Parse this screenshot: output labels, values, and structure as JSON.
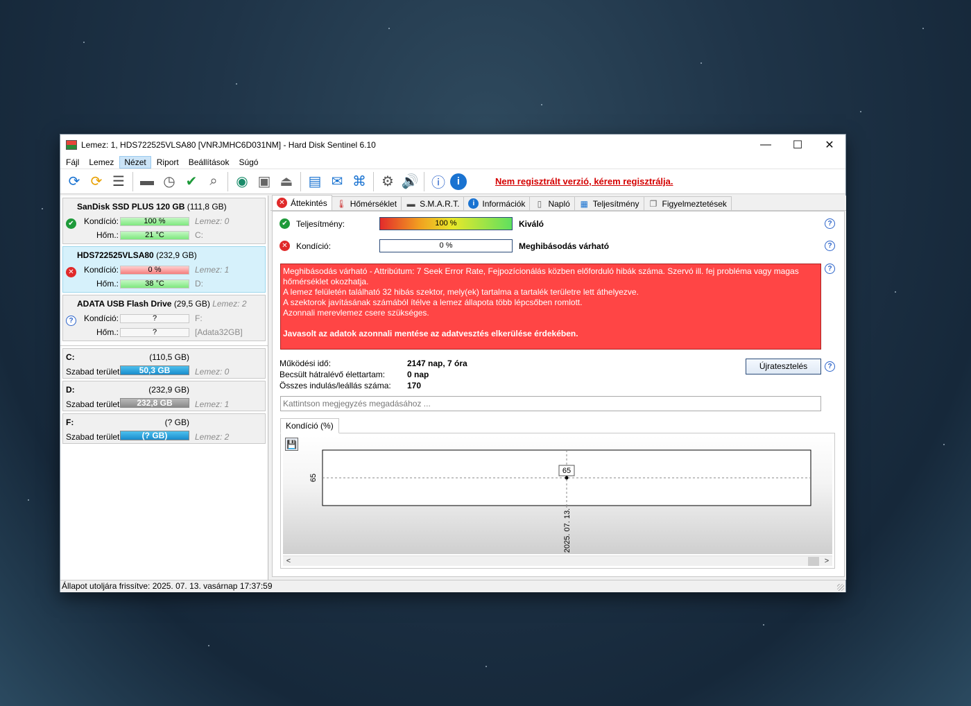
{
  "window": {
    "title": "Lemez: 1, HDS722525VLSA80 [VNRJMHC6D031NM]  -  Hard Disk Sentinel 6.10",
    "controls": {
      "minimize": "—",
      "maximize": "☐",
      "close": "✕"
    }
  },
  "menu": [
    "Fájl",
    "Lemez",
    "Nézet",
    "Riport",
    "Beállítások",
    "Súgó"
  ],
  "toolbar": {
    "icons": [
      "refresh-icon",
      "refresh-all-icon",
      "disk-list-icon",
      "disk-test-icon",
      "disk-schedule-icon",
      "disk-ok-icon",
      "disk-search-icon",
      "globe-icon",
      "drive-icon",
      "drive-eject-icon",
      "notepad-icon",
      "mail-icon",
      "network-icon",
      "settings-gear-icon",
      "speaker-icon",
      "help-icon",
      "info-icon"
    ],
    "register_link": "Nem regisztrált verzió, kérem regisztrálja."
  },
  "disks": [
    {
      "name": "SanDisk SSD PLUS 120 GB",
      "size": "(111,8 GB)",
      "status": "ok",
      "health_label": "Kondíció:",
      "health": "100 %",
      "health_color": "green",
      "disk_ref": "Lemez: 0",
      "temp_label": "Hőm.:",
      "temp": "21 °C",
      "temp_color": "green",
      "volume": "C:"
    },
    {
      "name": "HDS722525VLSA80",
      "size": "(232,9 GB)",
      "status": "error",
      "health_label": "Kondíció:",
      "health": "0 %",
      "health_color": "red",
      "disk_ref": "Lemez: 1",
      "temp_label": "Hőm.:",
      "temp": "38 °C",
      "temp_color": "green",
      "volume": "D:"
    },
    {
      "name": "ADATA   USB Flash Drive",
      "size": "(29,5 GB)",
      "size_extra": "Lemez: 2",
      "status": "unknown",
      "health_label": "Kondíció:",
      "health": "?",
      "health_color": "empty",
      "disk_ref": "F:",
      "temp_label": "Hőm.:",
      "temp": "?",
      "temp_color": "empty",
      "volume": "[Adata32GB]"
    }
  ],
  "volumes": [
    {
      "letter": "C:",
      "size": "(110,5 GB)",
      "label": "Szabad terület",
      "free": "50,3 GB",
      "bar": "blue",
      "disk_ref": "Lemez: 0"
    },
    {
      "letter": "D:",
      "size": "(232,9 GB)",
      "label": "Szabad terület",
      "free": "232,8 GB",
      "bar": "grey",
      "disk_ref": "Lemez: 1"
    },
    {
      "letter": "F:",
      "size": "(? GB)",
      "label": "Szabad terület",
      "free": "(? GB)",
      "bar": "blue",
      "disk_ref": "Lemez: 2"
    }
  ],
  "tabs": [
    {
      "label": "Áttekintés",
      "icon": "error-x-icon"
    },
    {
      "label": "Hőmérséklet",
      "icon": "thermometer-icon"
    },
    {
      "label": "S.M.A.R.T.",
      "icon": "smart-drive-icon"
    },
    {
      "label": "Információk",
      "icon": "info-icon"
    },
    {
      "label": "Napló",
      "icon": "log-page-icon"
    },
    {
      "label": "Teljesítmény",
      "icon": "performance-chart-icon"
    },
    {
      "label": "Figyelmeztetések",
      "icon": "alerts-icon"
    }
  ],
  "overview": {
    "performance_label": "Teljesítmény:",
    "performance_value": "100 %",
    "performance_fraction": 1.0,
    "performance_verdict": "Kiváló",
    "health_label": "Kondíció:",
    "health_value": "0 %",
    "health_fraction": 0.0,
    "health_verdict": "Meghibásodás várható",
    "alert_lines": [
      "Meghibásodás várható - Attribútum: 7 Seek Error Rate, Fejpozícionálás közben előforduló hibák száma. Szervó ill. fej probléma vagy magas hőmérséklet okozhatja.",
      "A lemez felületén található 32 hibás szektor, mely(ek) tartalma a tartalék területre lett áthelyezve.",
      "A szektorok javításának számából ítélve a lemez állapota több lépcsőben romlott.",
      "Azonnali merevlemez csere szükséges."
    ],
    "alert_strong": "Javasolt az adatok azonnali mentése az adatvesztés elkerülése érdekében.",
    "stats": [
      {
        "label": "Működési idő:",
        "value": "2147 nap, 7 óra"
      },
      {
        "label": "Becsült hátralévő élettartam:",
        "value": "0 nap"
      },
      {
        "label": "Összes indulás/leállás száma:",
        "value": "170"
      }
    ],
    "retest_button": "Újratesztelés",
    "note_placeholder": "Kattintson megjegyzés megadásához ...",
    "chart_tab": "Kondíció  (%)"
  },
  "chart_data": {
    "type": "line",
    "x": [
      "2025. 07. 13."
    ],
    "series": [
      {
        "values": [
          65
        ]
      }
    ],
    "y_tick": "65",
    "point_label": "65"
  },
  "statusbar": {
    "text": "Állapot utoljára frissítve: 2025. 07. 13. vasárnap 17:37:59"
  }
}
